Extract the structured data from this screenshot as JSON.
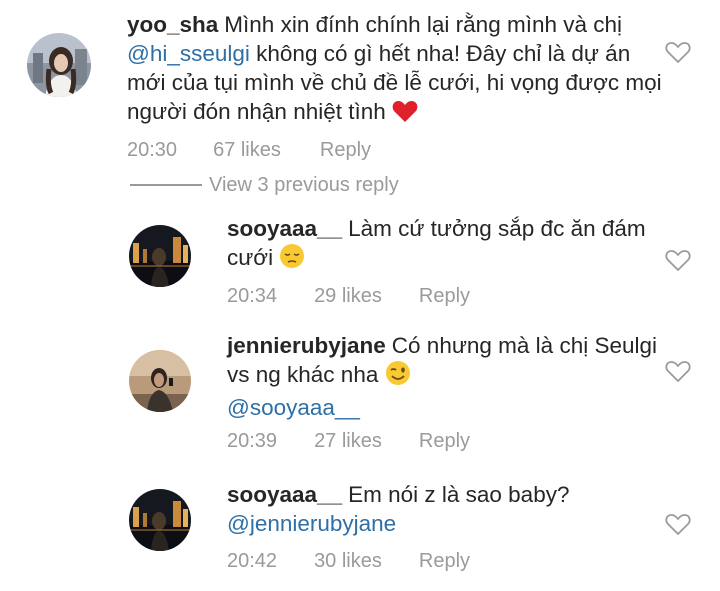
{
  "comments": [
    {
      "username": "yoo_sha",
      "text_before": "Mình xin đính chính lại rằng mình và chị ",
      "mention": "@hi_sseulgi",
      "text_after": " không có gì hết nha! Đây chỉ là dự án mới của tụi mình về chủ đề lễ cưới, hi vọng được mọi người đón nhận nhiệt tình",
      "emoji": "red-heart-emoji",
      "time": "20:30",
      "likes": "67 likes",
      "reply": "Reply"
    },
    {
      "username": "sooyaaa__",
      "text": "Làm cứ tưởng sắp đc ăn đám cưới",
      "emoji": "pensive-face-emoji",
      "time": "20:34",
      "likes": "29 likes",
      "reply": "Reply"
    },
    {
      "username": "jennierubyjane",
      "text": "Có nhưng mà là chị Seulgi vs ng khác nha",
      "emoji": "winking-face-emoji",
      "mention": "@sooyaaa__",
      "time": "20:39",
      "likes": "27 likes",
      "reply": "Reply"
    },
    {
      "username": "sooyaaa__",
      "text": "Em nói z là sao baby?",
      "mention": "@jennierubyjane",
      "time": "20:42",
      "likes": "30 likes",
      "reply": "Reply"
    }
  ],
  "view_previous": "View 3 previous reply",
  "icons": {
    "like": "heart-outline-icon"
  },
  "colors": {
    "mention": "#2e6fa6",
    "meta": "#9a9a9a",
    "heart": "#e0202a"
  }
}
